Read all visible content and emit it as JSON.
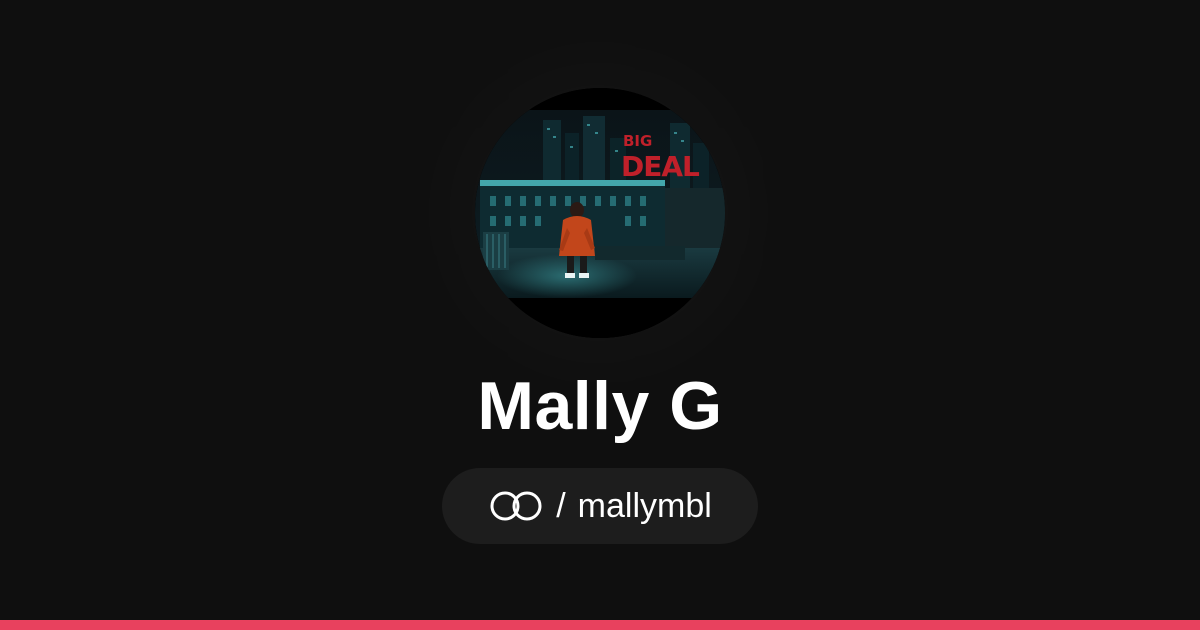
{
  "profile": {
    "name": "Mally G",
    "separator": "/",
    "handle": "mallymbl",
    "avatar_text_top": "BIG",
    "avatar_text_bottom": "DEAL"
  },
  "icons": {
    "link": "double-ring-link-icon"
  },
  "colors": {
    "background": "#0f0f0f",
    "pill": "#1d1d1d",
    "accent": "#e8415e",
    "text": "#ffffff"
  }
}
